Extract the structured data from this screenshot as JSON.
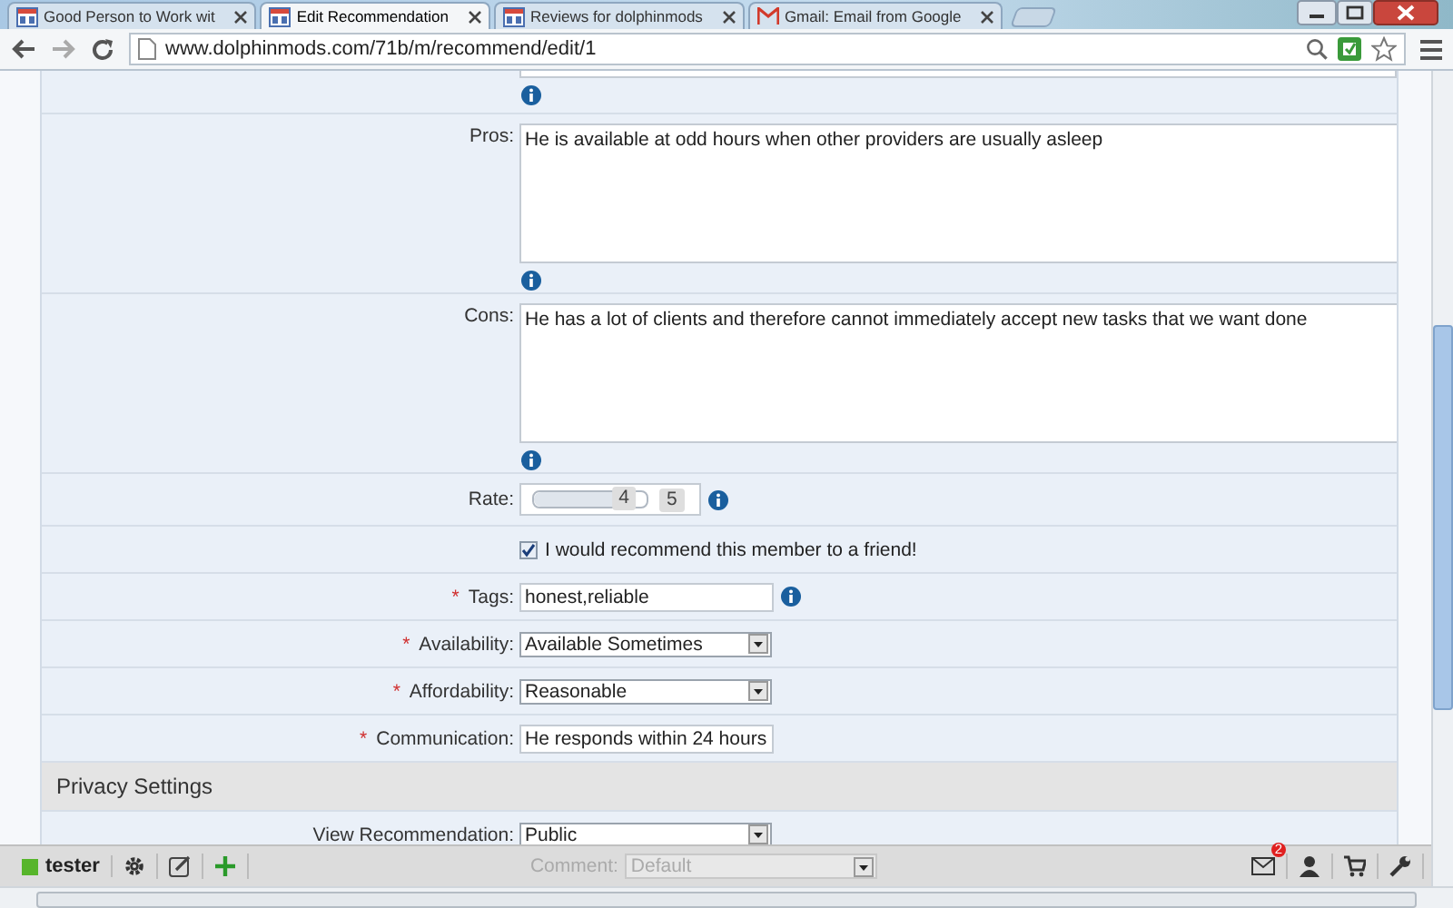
{
  "browser": {
    "tabs": [
      {
        "label": "Good Person to Work wit",
        "selected": false
      },
      {
        "label": "Edit Recommendation",
        "selected": true
      },
      {
        "label": "Reviews for dolphinmods",
        "selected": false
      },
      {
        "label": "Gmail: Email from Google",
        "selected": false
      }
    ],
    "url": "www.dolphinmods.com/71b/m/recommend/edit/1"
  },
  "form": {
    "rows": [
      {
        "kind": "tail",
        "info": true
      },
      {
        "kind": "textarea",
        "label": "Pros:",
        "value": "He is available at odd hours when other providers are usually asleep",
        "info": true
      },
      {
        "kind": "textarea",
        "label": "Cons:",
        "value": "He has a lot of clients and therefore cannot immediately accept new tasks that we want done",
        "info": true
      },
      {
        "kind": "rate",
        "label": "Rate:",
        "value": "4",
        "max": "5",
        "level": 0.8,
        "info": true
      },
      {
        "kind": "checkbox",
        "label": "I would recommend this member to a friend!",
        "checked": true
      },
      {
        "kind": "text",
        "label": "Tags:",
        "marker": "*",
        "value": "honest,reliable",
        "info": true
      },
      {
        "kind": "select",
        "label": "Availability:",
        "marker": "*",
        "value": "Available Sometimes"
      },
      {
        "kind": "select",
        "label": "Affordability:",
        "marker": "*",
        "value": "Reasonable"
      },
      {
        "kind": "text",
        "label": "Communication:",
        "marker": "*",
        "value": "He responds within 24 hours",
        "info": false
      },
      {
        "kind": "section",
        "label": "Privacy Settings"
      },
      {
        "kind": "select",
        "label": "View Recommendation:",
        "value": "Public"
      }
    ]
  },
  "bottom_bar": {
    "user": "tester",
    "comment": {
      "label": "Comment:",
      "value": "Default",
      "disabled": true
    },
    "mail_badge": "2"
  }
}
